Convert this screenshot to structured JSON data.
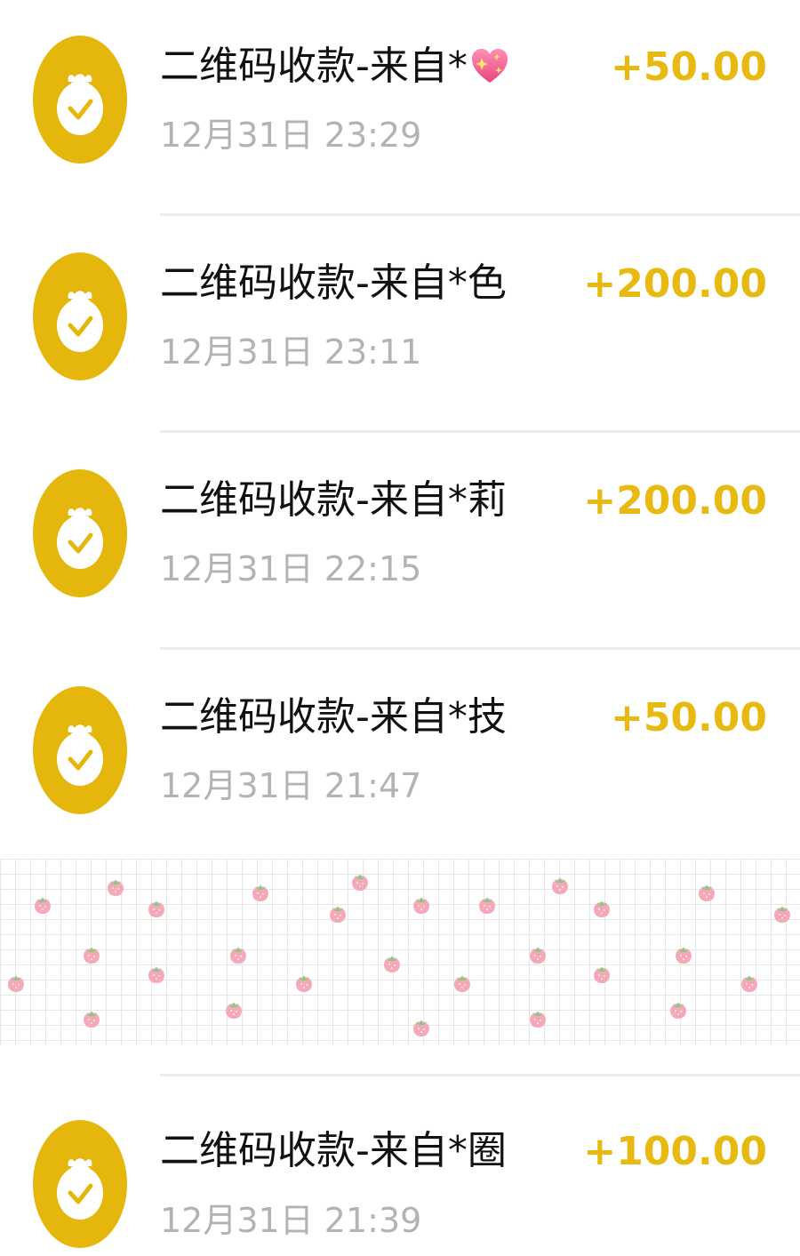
{
  "transactions": [
    {
      "title": "二维码收款-来自*",
      "emoji": "heart",
      "time": "12月31日 23:29",
      "amount": "+50.00"
    },
    {
      "title": "二维码收款-来自*色",
      "emoji": "",
      "time": "12月31日 23:11",
      "amount": "+200.00"
    },
    {
      "title": "二维码收款-来自*莉",
      "emoji": "",
      "time": "12月31日 22:15",
      "amount": "+200.00"
    },
    {
      "title": "二维码收款-来自*技",
      "emoji": "",
      "time": "12月31日 21:47",
      "amount": "+50.00"
    },
    {
      "title": "二维码收款-来自*圈",
      "emoji": "",
      "time": "12月31日 21:39",
      "amount": "+100.00"
    }
  ],
  "icons": {
    "row_icon": "money-bag-check-icon",
    "emoji": "sparkling-heart-icon",
    "banner_pattern": "strawberry-icon"
  },
  "colors": {
    "icon_background": "#E5B60B",
    "amount": "#E8B911",
    "title": "#111111",
    "time": "#b3b3b3",
    "divider": "#ececec",
    "banner_grid": "#e6e6e6",
    "strawberry": "#f5a9b8"
  }
}
